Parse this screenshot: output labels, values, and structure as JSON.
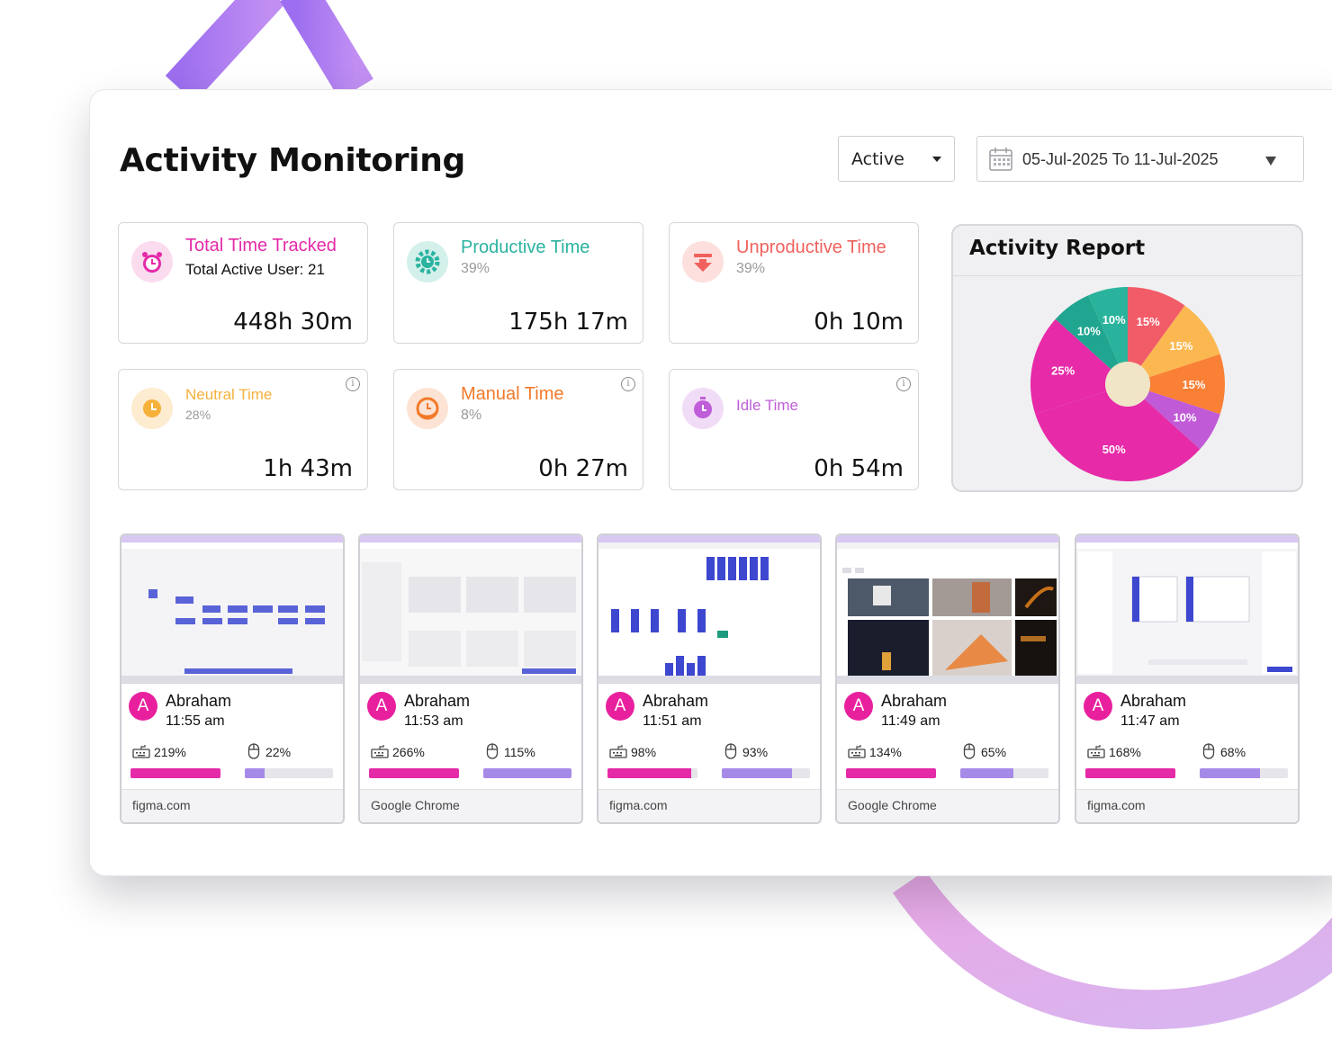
{
  "page": {
    "title": "Activity Monitoring"
  },
  "filters": {
    "status": "Active",
    "date_range": "05-Jul-2025 To 11-Jul-2025"
  },
  "colors": {
    "pink": "#e52aa8",
    "teal": "#2bb3a0",
    "red": "#f0615d",
    "amber": "#f5b13a",
    "orange": "#f27a2a",
    "violet": "#bf5ed8",
    "purple_accent": "#a78ae8"
  },
  "stats": [
    {
      "label": "Total Time Tracked",
      "sub": "Total Active User: 21",
      "value": "448h 30m",
      "icon": "alarm-clock-icon",
      "color": "#e52aa8"
    },
    {
      "label": "Productive Time",
      "sub": "39%",
      "value": "175h 17m",
      "icon": "gear-clock-icon",
      "color": "#2bb3a0"
    },
    {
      "label": "Unproductive Time",
      "sub": "39%",
      "value": "0h 10m",
      "icon": "down-arrow-icon",
      "color": "#f0615d"
    },
    {
      "label": "Neutral Time",
      "sub": "28%",
      "value": "1h 43m",
      "icon": "clock-icon",
      "color": "#f5b13a"
    },
    {
      "label": "Manual Time",
      "sub": "8%",
      "value": "0h 27m",
      "icon": "hand-clock-icon",
      "color": "#f27a2a"
    },
    {
      "label": "Idle Time",
      "sub": "",
      "value": "0h 54m",
      "icon": "timer-icon",
      "color": "#bf5ed8"
    }
  ],
  "report": {
    "title": "Activity Report"
  },
  "chart_data": {
    "type": "pie",
    "title": "Activity Report",
    "slices": [
      {
        "label": "15%",
        "value": 15,
        "color": "#f25b68"
      },
      {
        "label": "15%",
        "value": 15,
        "color": "#fbb851"
      },
      {
        "label": "15%",
        "value": 15,
        "color": "#fa8035"
      },
      {
        "label": "10%",
        "value": 10,
        "color": "#c05ad6"
      },
      {
        "label": "50%",
        "value": 50,
        "color": "#e62aa8"
      },
      {
        "label": "25%",
        "value": 25,
        "color": "#e62aa8"
      },
      {
        "label": "10%",
        "value": 10,
        "color": "#20a590"
      },
      {
        "label": "10%",
        "value": 10,
        "color": "#2ab39c"
      }
    ]
  },
  "cards": [
    {
      "name": "Abraham",
      "initial": "A",
      "time": "11:55 am",
      "keyboard": "219%",
      "mouse": "22%",
      "keyboard_fill": 1.0,
      "mouse_fill": 0.22,
      "app": "figma.com",
      "shot": "diagram"
    },
    {
      "name": "Abraham",
      "initial": "A",
      "time": "11:53 am",
      "keyboard": "266%",
      "mouse": "115%",
      "keyboard_fill": 1.0,
      "mouse_fill": 1.0,
      "app": "Google Chrome",
      "shot": "blank"
    },
    {
      "name": "Abraham",
      "initial": "A",
      "time": "11:51 am",
      "keyboard": "98%",
      "mouse": "93%",
      "keyboard_fill": 0.93,
      "mouse_fill": 0.8,
      "app": "figma.com",
      "shot": "bars"
    },
    {
      "name": "Abraham",
      "initial": "A",
      "time": "11:49 am",
      "keyboard": "134%",
      "mouse": "65%",
      "keyboard_fill": 1.0,
      "mouse_fill": 0.6,
      "app": "Google Chrome",
      "shot": "photos"
    },
    {
      "name": "Abraham",
      "initial": "A",
      "time": "11:47 am",
      "keyboard": "168%",
      "mouse": "68%",
      "keyboard_fill": 1.0,
      "mouse_fill": 0.68,
      "app": "figma.com",
      "shot": "editor"
    }
  ]
}
